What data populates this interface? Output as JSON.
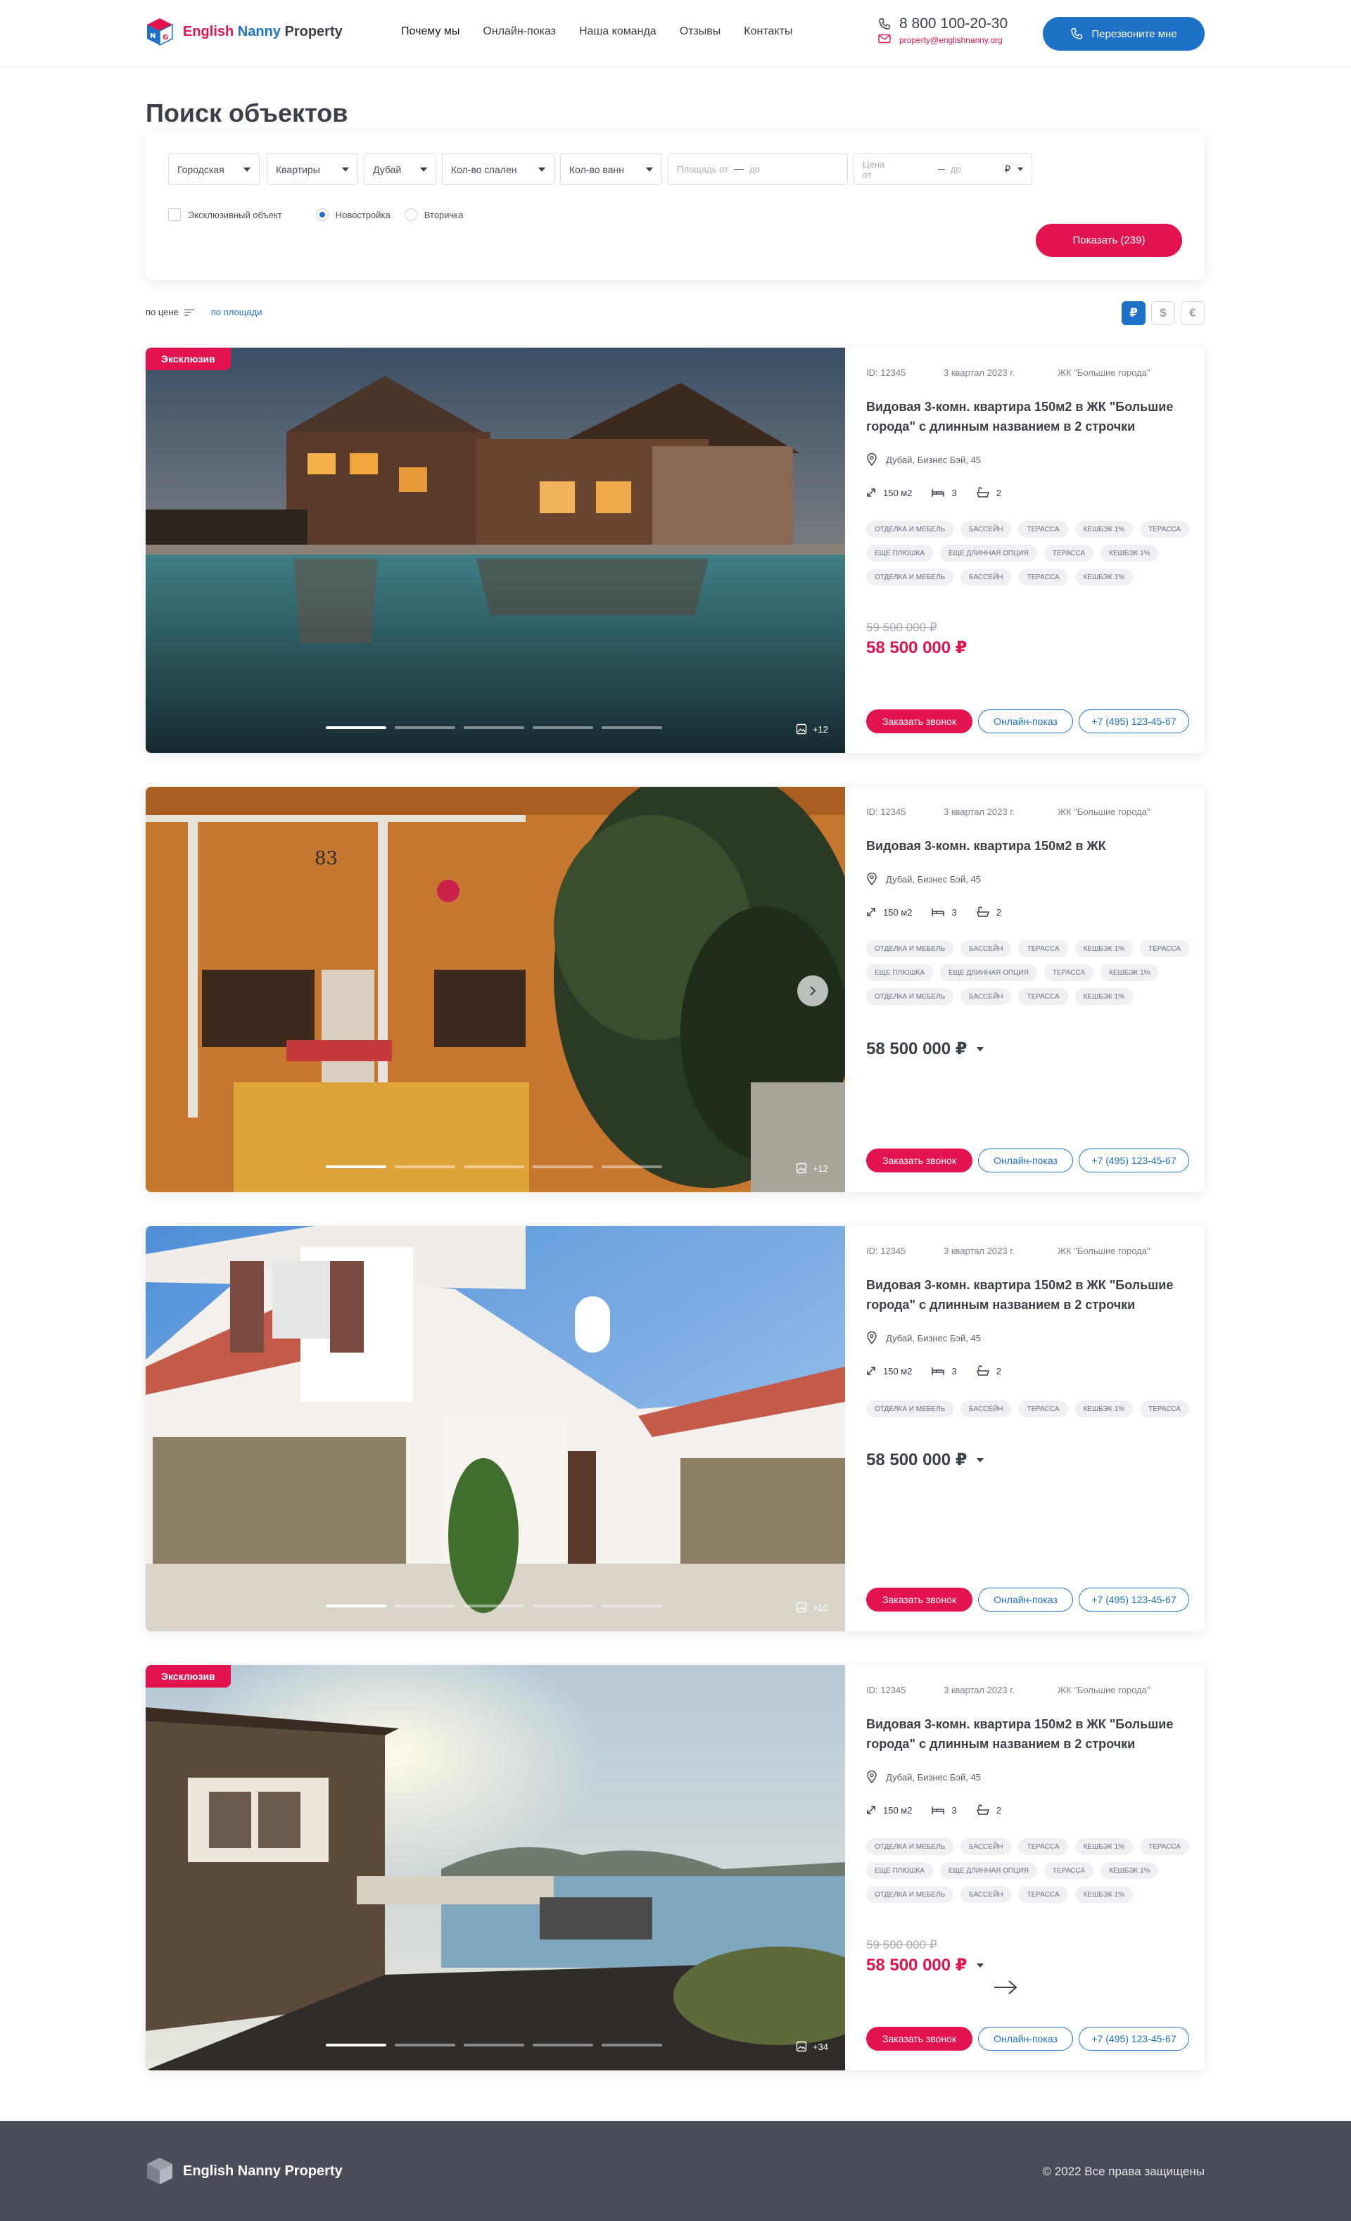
{
  "brand": {
    "part1": "English",
    "part2": "Nanny",
    "part3": "Property",
    "full": "English Nanny Property"
  },
  "nav": [
    "Почему мы",
    "Онлайн-показ",
    "Наша команда",
    "Отзывы",
    "Контакты"
  ],
  "contact": {
    "phone": "8 800 100-20-30",
    "email": "property@englishnanny.org",
    "callback_label": "Перезвоните мне"
  },
  "search": {
    "title": "Поиск объектов",
    "filters": [
      "Городская",
      "Квартиры",
      "Дубай",
      "Кол-во спален",
      "Кол-во ванн"
    ],
    "area_from": "Площадь от",
    "area_to": "до",
    "price_from": "Цена от",
    "price_to": "до",
    "currency_symbol": "₽",
    "exclusive_label": "Эксклюзивный объект",
    "new_label": "Новостройка",
    "resale_label": "Вторичка",
    "show_button": "Показать (239)"
  },
  "sort": {
    "by_price": "по цене",
    "by_area": "по площади",
    "currencies": [
      "₽",
      "$",
      "€"
    ]
  },
  "listings": [
    {
      "badge": "Эксклюзив",
      "id": "ID: 12345",
      "date": "3 квартал 2023 г.",
      "complex": "ЖК \"Большие города\"",
      "title": "Видовая 3-комн. квартира 150м2 в ЖК \"Большие города\"  с длинным названием в 2 строчки",
      "address": "Дубай, Бизнес Бэй, 45",
      "area": "150 м2",
      "beds": "3",
      "baths": "2",
      "tags": [
        "ОТДЕЛКА И МЕБЕЛЬ",
        "БАССЕЙН",
        "ТЕРАССА",
        "КЕШБЭК 1%",
        "ТЕРАССА",
        "ЕЩЕ ПЛЮШКА",
        "ЕЩЕ ДЛИННАЯ ОПЦИЯ",
        "ТЕРАССА",
        "КЕШБЭК 1%",
        "ОТДЕЛКА И МЕБЕЛЬ",
        "БАССЕЙН",
        "ТЕРАССА",
        "КЕШБЭК 1%"
      ],
      "old_price": "59 500 000 ₽",
      "price": "58 500 000 ₽",
      "photos": "+12",
      "call_label": "Заказать звонок",
      "online_label": "Онлайн-показ",
      "phone_label": "+7 (495) 123-45-67"
    },
    {
      "badge": "",
      "id": "ID: 12345",
      "date": "3 квартал 2023 г.",
      "complex": "ЖК \"Большие города\"",
      "title": "Видовая 3-комн. квартира 150м2 в ЖК",
      "address": "Дубай, Бизнес Бэй, 45",
      "area": "150 м2",
      "beds": "3",
      "baths": "2",
      "tags": [
        "ОТДЕЛКА И МЕБЕЛЬ",
        "БАССЕЙН",
        "ТЕРАССА",
        "КЕШБЭК 1%",
        "ТЕРАССА",
        "ЕЩЕ ПЛЮШКА",
        "ЕЩЕ ДЛИННАЯ ОПЦИЯ",
        "ТЕРАССА",
        "КЕШБЭК 1%",
        "ОТДЕЛКА И МЕБЕЛЬ",
        "БАССЕЙН",
        "ТЕРАССА",
        "КЕШБЭК 1%"
      ],
      "old_price": "",
      "price": "58 500 000 ₽",
      "photos": "+12",
      "call_label": "Заказать звонок",
      "online_label": "Онлайн-показ",
      "phone_label": "+7 (495) 123-45-67"
    },
    {
      "badge": "",
      "id": "ID: 12345",
      "date": "3 квартал 2023 г.",
      "complex": "ЖК \"Большие города\"",
      "title": "Видовая 3-комн. квартира 150м2 в ЖК \"Большие города\"  с длинным названием в 2 строчки",
      "address": "Дубай, Бизнес Бэй, 45",
      "area": "150 м2",
      "beds": "3",
      "baths": "2",
      "tags": [
        "ОТДЕЛКА И МЕБЕЛЬ",
        "БАССЕЙН",
        "ТЕРАССА",
        "КЕШБЭК 1%",
        "ТЕРАССА"
      ],
      "old_price": "",
      "price": "58 500 000 ₽",
      "photos": "+10",
      "call_label": "Заказать звонок",
      "online_label": "Онлайн-показ",
      "phone_label": "+7 (495) 123-45-67"
    },
    {
      "badge": "Эксклюзив",
      "id": "ID: 12345",
      "date": "3 квартал 2023 г.",
      "complex": "ЖК \"Большие города\"",
      "title": "Видовая 3-комн. квартира 150м2 в ЖК \"Большие города\"  с длинным названием в 2 строчки",
      "address": "Дубай, Бизнес Бэй, 45",
      "area": "150 м2",
      "beds": "3",
      "baths": "2",
      "tags": [
        "ОТДЕЛКА И МЕБЕЛЬ",
        "БАССЕЙН",
        "ТЕРАССА",
        "КЕШБЭК 1%",
        "ТЕРАССА",
        "ЕЩЕ ПЛЮШКА",
        "ЕЩЕ ДЛИННАЯ ОПЦИЯ",
        "ТЕРАССА",
        "КЕШБЭК 1%",
        "ОТДЕЛКА И МЕБЕЛЬ",
        "БАССЕЙН",
        "ТЕРАССА",
        "КЕШБЭК 1%"
      ],
      "old_price": "59 500 000 ₽",
      "price": "58 500 000 ₽",
      "photos": "+34",
      "call_label": "Заказать звонок",
      "online_label": "Онлайн-показ",
      "phone_label": "+7 (495) 123-45-67"
    }
  ],
  "footer": {
    "copyright": "© 2022 Все права защищены"
  },
  "colors": {
    "accent_red": "#e2134e",
    "accent_blue": "#1d72c7",
    "footer_bg": "#4a4d59"
  }
}
